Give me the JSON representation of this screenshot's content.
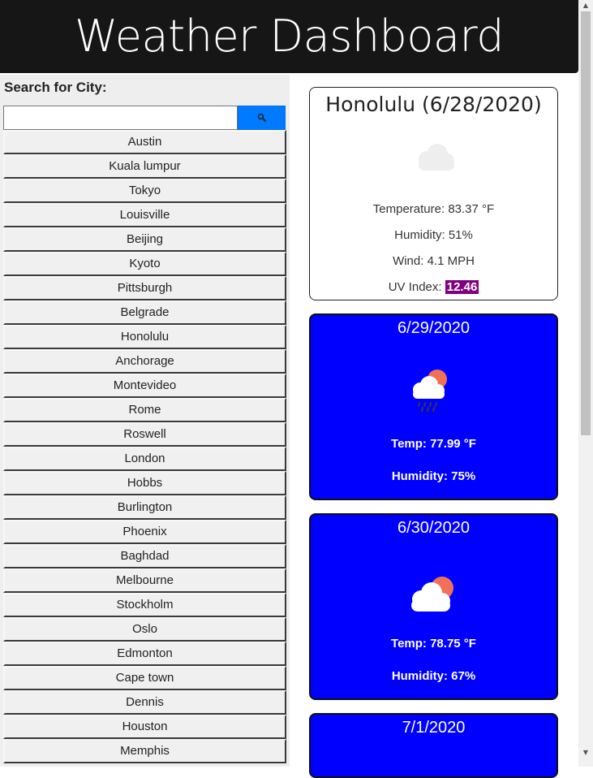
{
  "header": {
    "title": "Weather Dashboard"
  },
  "sidebar": {
    "search_label": "Search for City:",
    "search_value": "",
    "cities": [
      "Austin",
      "Kuala lumpur",
      "Tokyo",
      "Louisville",
      "Beijing",
      "Kyoto",
      "Pittsburgh",
      "Belgrade",
      "Honolulu",
      "Anchorage",
      "Montevideo",
      "Rome",
      "Roswell",
      "London",
      "Hobbs",
      "Burlington",
      "Phoenix",
      "Baghdad",
      "Melbourne",
      "Stockholm",
      "Oslo",
      "Edmonton",
      "Cape town",
      "Dennis",
      "Houston",
      "Memphis"
    ]
  },
  "current": {
    "title": "Honolulu (6/28/2020)",
    "icon": "cloud-icon",
    "temperature": "Temperature: 83.37 °F",
    "humidity": "Humidity: 51%",
    "wind": "Wind: 4.1 MPH",
    "uv_label": "UV Index: ",
    "uv_value": "12.46"
  },
  "forecast": [
    {
      "date": "6/29/2020",
      "icon": "rain-cloud-sun-icon",
      "temp": "Temp: 77.99 °F",
      "humidity": "Humidity: 75%"
    },
    {
      "date": "6/30/2020",
      "icon": "cloud-sun-icon",
      "temp": "Temp: 78.75 °F",
      "humidity": "Humidity: 67%"
    },
    {
      "date": "7/1/2020"
    }
  ],
  "colors": {
    "header_bg": "#161616",
    "forecast_bg": "#0000ff",
    "search_button": "#007bff",
    "uv_badge": "#800080",
    "sidebar_bg": "#eeeeee"
  }
}
